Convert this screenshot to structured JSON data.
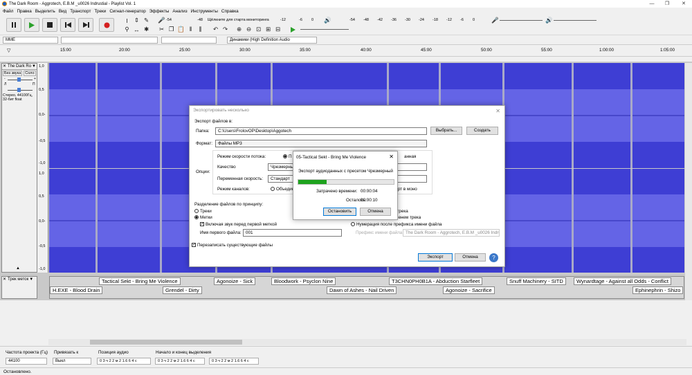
{
  "titlebar": {
    "title": "The Dark Room - Aggrotech, E.B.M _u0026 Indrustial - Playlist Vol. 1"
  },
  "menu": [
    "Файл",
    "Правка",
    "Выделить",
    "Вид",
    "Транспорт",
    "Треки",
    "Сигнал-генератор",
    "Эффекты",
    "Анализ",
    "Инструменты",
    "Справка"
  ],
  "meters": {
    "rec_hint": "Щёлкните для старта мониторинга",
    "rec_ticks": [
      "-54",
      "-48",
      "-12",
      "-6",
      "0"
    ],
    "play_ticks": [
      "-54",
      "-48",
      "-42",
      "-36",
      "-30",
      "-24",
      "-18",
      "-12",
      "-6",
      "0"
    ]
  },
  "devices": {
    "host": "MME",
    "output": "Динамики (High Definition Audio"
  },
  "ruler": {
    "ticks": [
      "15:00",
      "20:00",
      "25:00",
      "30:00",
      "35:00",
      "40:00",
      "45:00",
      "50:00",
      "55:00",
      "1:00:00",
      "1:05:00"
    ]
  },
  "track": {
    "name": "The Dark Ro",
    "mute": "Без звука",
    "solo": "Соло",
    "left": "Л",
    "right": "П",
    "info1": "Стерео, 44100Гц,",
    "info2": "32-бит float",
    "scale": [
      "1,0",
      "0,5",
      "0,0-",
      "-0,5",
      "-1,0"
    ]
  },
  "labeltrack": {
    "name": "Трек меток",
    "labels_top": [
      "Tactical Sekt - Bring Me Violence",
      "Agonoize - Sick",
      "Bloodwork - Psyclon Nine",
      "T3CHN0PH0B1A - Abduction Starfleet",
      "Snuff Machinery - SITD",
      "Wynardtage - Against all Odds - Conflict"
    ],
    "labels_bottom": [
      "H.EXE - Blood Drain",
      "Grendel - Dirty",
      "Dawn of Ashes - Nail Driven",
      "Agonoize - Sacrifice",
      "Ephinephrin - Shizo"
    ]
  },
  "export": {
    "title": "Экспортировать несколько",
    "section": "Экспорт файлов в:",
    "folder_label": "Папка:",
    "folder": "C:\\Users\\FrolovOP\\Desktop\\Aggotech",
    "browse": "Выбрать...",
    "create": "Создать",
    "format_label": "Формат:",
    "format": "Файлы MP3",
    "options_label": "Опции:",
    "bitrate_mode": "Режим скорости потока:",
    "quality": "Качество",
    "quality_val": "Чрезмерный",
    "var_speed": "Переменная скорость:",
    "var_speed_val": "Стандарт",
    "channel_mode": "Режим каналов:",
    "joint": "Объедин",
    "mode_p": "П",
    "mode_right": "анная",
    "mono": "порт в моно",
    "split_title": "Разделение файлов по принципу:",
    "tracks": "Треки",
    "labels": "Метки",
    "include_before": "Включая звук перед первой меткой",
    "first_name_label": "Имя первого файла:",
    "first_name": "001",
    "name_track": "мима трека",
    "name_prefix": "кой/именем трека",
    "numbering": "Нумерация после префикса имени файла",
    "prefix_label": "Префикс имени файла:",
    "prefix": "The Dark Room - Aggrotech, E.B.M _u0026 Indru",
    "overwrite": "Перезаписать существующие файлы",
    "export_btn": "Экспорт",
    "cancel_btn": "Отмена"
  },
  "progress": {
    "title": "05-Tactical Sekt - Bring Me Violence",
    "msg": "Экспорт аудиоданных с пресетом Чрезмерный",
    "elapsed_label": "Затрачено времени:",
    "elapsed": "00:00:04",
    "remaining_label": "Осталось:",
    "remaining": "00:00:10",
    "stop": "Остановить",
    "cancel": "Отмена",
    "fraction": 0.3
  },
  "bottom": {
    "rate_label": "Частота проекта (Гц)",
    "rate": "44100",
    "snap_label": "Привязать к",
    "snap": "Выкл",
    "pos_label": "Позиция аудио",
    "pos": "0 3 ч 2 2 м 2 1.6 6 4 с",
    "sel_label": "Начало и конец выделения",
    "sel_start": "0 3 ч 2 2 м 2 1.6 6 4 с",
    "sel_end": "0 3 ч 2 2 м 2 1.6 6 4 с"
  },
  "status": "Остановлено.",
  "colors": {
    "wave": "#3e3ed4",
    "rms": "#6464e6",
    "track_bg": "#c9c9c9",
    "play_green": "#2ca12c",
    "record_red": "#d41e1e",
    "progress_green": "#1ea31e"
  }
}
